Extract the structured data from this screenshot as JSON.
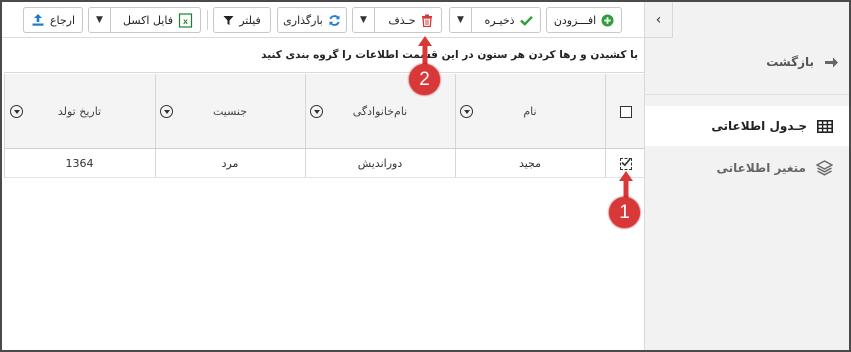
{
  "toolbar": {
    "add_label": "افـــزودن",
    "save_label": "ذخیـره",
    "delete_label": "حـذف",
    "refresh_label": "بارگذاری",
    "filter_label": "فیلتر",
    "excel_label": "فایل اکسل",
    "export_label": "ارجاع"
  },
  "group_hint": "با کشیدن و رها کردن هر ستون در این قسمت اطلاعات را گروه بندی کنید",
  "sidebar": {
    "back_label": "بازگشت",
    "items": [
      {
        "label": "جـدول اطلاعاتی",
        "icon": "table-icon",
        "active": true
      },
      {
        "label": "متغیر اطلاعاتی",
        "icon": "layers-icon",
        "active": false
      }
    ]
  },
  "table": {
    "columns": [
      "نام",
      "نام‌خانوادگی",
      "جنسیت",
      "تاریخ تولد"
    ],
    "rows": [
      {
        "checked": true,
        "first_name": "مجید",
        "last_name": "دوراندیش",
        "gender": "مرد",
        "birth_date": "1364"
      }
    ]
  },
  "annotations": {
    "marker1": "1",
    "marker2": "2"
  },
  "colors": {
    "green": "#2e9e3a",
    "red": "#d93838",
    "blue": "#1f7bd0",
    "excel_green": "#1e7e34"
  }
}
